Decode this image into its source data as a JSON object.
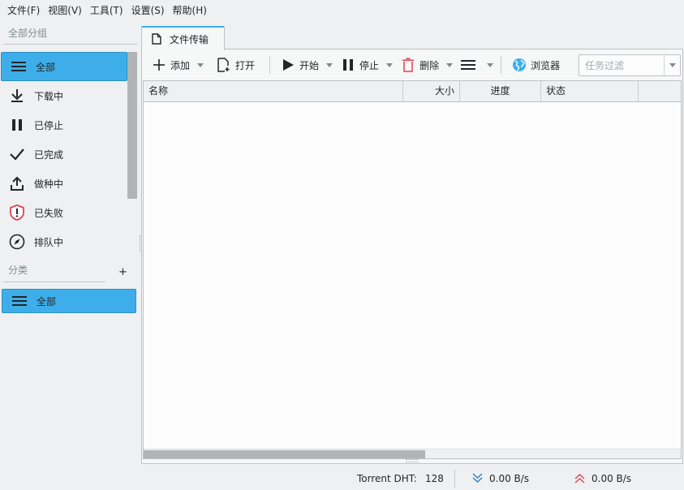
{
  "menu": [
    "文件(F)",
    "视图(V)",
    "工具(T)",
    "设置(S)",
    "帮助(H)"
  ],
  "sidebar": {
    "group_header": "全部分组",
    "items": [
      {
        "label": "全部",
        "icon": "hamburger-icon",
        "selected": true
      },
      {
        "label": "下载中",
        "icon": "download-icon"
      },
      {
        "label": "已停止",
        "icon": "pause-icon"
      },
      {
        "label": "已完成",
        "icon": "check-icon"
      },
      {
        "label": "做种中",
        "icon": "upload-icon"
      },
      {
        "label": "已失败",
        "icon": "error-shield-icon"
      },
      {
        "label": "排队中",
        "icon": "compass-icon"
      }
    ],
    "category_header": "分类",
    "category_add": "+",
    "category_items": [
      {
        "label": "全部",
        "icon": "hamburger-icon",
        "selected": true
      }
    ]
  },
  "tabs": [
    {
      "label": "文件传输",
      "icon": "document-icon"
    }
  ],
  "toolbar": {
    "add_label": "添加",
    "open_label": "打开",
    "start_label": "开始",
    "stop_label": "停止",
    "delete_label": "删除",
    "browser_label": "浏览器",
    "filter_placeholder": "任务过滤"
  },
  "table": {
    "columns": [
      "名称",
      "大小",
      "进度",
      "状态"
    ],
    "rows": []
  },
  "status": {
    "dht_label": "Torrent DHT:",
    "dht_value": "128",
    "download_speed": "0.00 B/s",
    "upload_speed": "0.00 B/s"
  },
  "colors": {
    "accent": "#3daee9",
    "error": "#da4453",
    "download_speed": "#2980b9",
    "upload_speed": "#da4453"
  }
}
